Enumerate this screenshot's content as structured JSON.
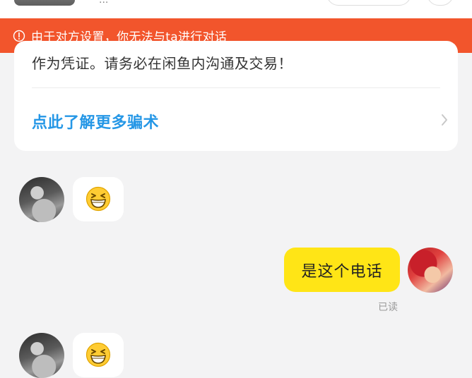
{
  "header": {
    "subtitle": "...",
    "thumbnail_icon": "product-thumbnail"
  },
  "banner": {
    "icon": "alert-circle-icon",
    "text": "由于对方设置，你无法与ta进行对话",
    "background_color": "#f2552c"
  },
  "notice_card": {
    "text": "作为凭证。请务必在闲鱼内沟通及交易！",
    "link_label": "点此了解更多骗术",
    "link_color": "#2597e6",
    "chevron_icon": "chevron-right-icon"
  },
  "messages": [
    {
      "sender": "other",
      "type": "emoji",
      "emoji": "grinning-squinting-face"
    },
    {
      "sender": "self",
      "type": "text",
      "text": "是这个电话",
      "status": "已读",
      "bubble_color": "#ffe516"
    },
    {
      "sender": "other",
      "type": "emoji",
      "emoji": "grinning-squinting-face"
    }
  ]
}
